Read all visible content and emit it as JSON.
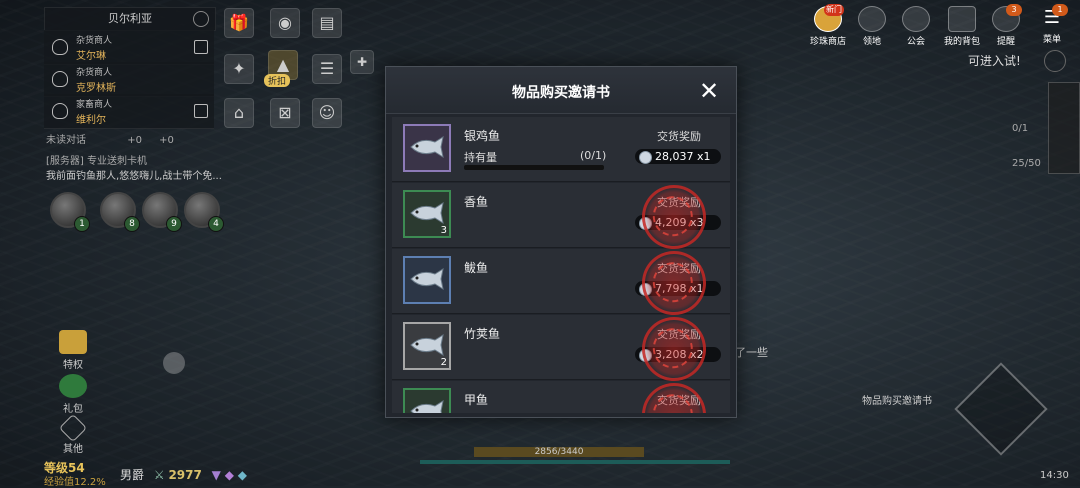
{
  "region": {
    "title": "贝尔利亚"
  },
  "npcs": [
    {
      "role": "杂货商人",
      "name": "艾尔琳"
    },
    {
      "role": "杂货商人",
      "name": "克罗林斯"
    },
    {
      "role": "家畜商人",
      "name": "维利尔"
    }
  ],
  "chat": {
    "unread_label": "未读对话",
    "counter_a": "+0",
    "counter_b": "+0",
    "line1": "[服务器] 专业送刺卡机",
    "line2": "我前面钓鱼那人,悠悠嗨儿,战士带个免..."
  },
  "party": [
    "1",
    "8",
    "9",
    "4"
  ],
  "top_icons": {
    "discount_label": "折扣"
  },
  "top_right": [
    {
      "label": "珍珠商店",
      "badge": "新门",
      "icon": "shop-icon"
    },
    {
      "label": "领地",
      "badge": "",
      "icon": "territory-icon"
    },
    {
      "label": "公会",
      "badge": "",
      "icon": "guild-icon"
    },
    {
      "label": "我的背包",
      "badge": "",
      "icon": "bag-icon"
    },
    {
      "label": "提醒",
      "badge": "3",
      "icon": "bell-icon"
    },
    {
      "label": "菜单",
      "badge": "1",
      "icon": "menu-icon"
    }
  ],
  "enter_text": "可进入试!",
  "quest_counts": [
    "0/1",
    "25/50"
  ],
  "left_buttons": [
    "特权",
    "礼包",
    "其他"
  ],
  "bottom": {
    "level": "等级54",
    "exp": "经验值12.2%",
    "title": "男爵",
    "power": "2977",
    "hp": "2856/3440",
    "time": "14:30"
  },
  "quest_float": "物品购买邀请书",
  "faded_text": "了一些",
  "dialog": {
    "title": "物品购买邀请书",
    "close_label": "✕",
    "reward_label": "交货奖励",
    "hold_label": "持有量",
    "items": [
      {
        "name": "银鸡鱼",
        "holding": "(0/1)",
        "reward": "28,037 x1",
        "qty": "",
        "grade": "purple",
        "done": false
      },
      {
        "name": "香鱼",
        "holding": "",
        "reward": "4,209 x3",
        "qty": "3",
        "grade": "green",
        "done": true
      },
      {
        "name": "鲅鱼",
        "holding": "",
        "reward": "7,798 x1",
        "qty": "",
        "grade": "blue",
        "done": true
      },
      {
        "name": "竹荚鱼",
        "holding": "",
        "reward": "3,208 x2",
        "qty": "2",
        "grade": "white",
        "done": true
      },
      {
        "name": "甲鱼",
        "holding": "",
        "reward": "",
        "qty": "",
        "grade": "green",
        "done": true
      }
    ]
  }
}
